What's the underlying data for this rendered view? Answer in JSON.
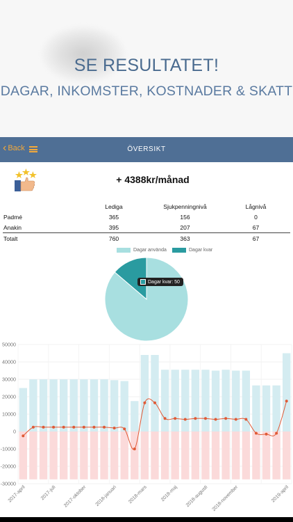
{
  "promo": {
    "title": "SE RESULTATET!",
    "subtitle": "DAGAR, INKOMSTER, KOSTNADER & SKATT"
  },
  "nav": {
    "back_label": "Back",
    "title": "ÖVERSIKT",
    "icons": [
      "chevron-left-icon",
      "hamburger-menu-icon"
    ],
    "accent_color": "#f3a93a",
    "bar_color": "#4f6f95"
  },
  "summary": {
    "icon": "thumbs-up-stars-icon",
    "headline": "+ 4388kr/månad",
    "columns": [
      "",
      "Lediga",
      "Sjukpenningnivå",
      "Lågnivå"
    ],
    "rows": [
      {
        "name": "Padmé",
        "values": [
          "365",
          "156",
          "0"
        ]
      },
      {
        "name": "Anakin",
        "values": [
          "395",
          "207",
          "67"
        ]
      }
    ],
    "total": {
      "name": "Totalt",
      "values": [
        "760",
        "363",
        "67"
      ]
    }
  },
  "pie": {
    "legend": [
      "Dagar använda",
      "Dagar kvar"
    ],
    "colors": [
      "#a8dfe0",
      "#2a9ba0"
    ],
    "tooltip": "Dagar kvar: 50",
    "chart_data": {
      "type": "pie",
      "labels": [
        "Dagar använda",
        "Dagar kvar"
      ],
      "values": [
        313,
        50
      ]
    }
  },
  "chart_data": {
    "type": "bar",
    "ylim": [
      -30000,
      50000
    ],
    "y_ticks": [
      "50000",
      "40000",
      "30000",
      "20000",
      "10000",
      "0",
      "-10000",
      "-20000",
      "-30000"
    ],
    "x_labels": [
      "2017-april",
      "2017-juli",
      "2017-oktober",
      "2018-januari",
      "2018-mars",
      "2018-maj",
      "2018-augusti",
      "2018-november",
      "2019-april"
    ],
    "bar_color_positive": "#d4ecf1",
    "bar_color_negative": "#fbdada",
    "line_color": "#e05a36",
    "positive": [
      25000,
      30000,
      30000,
      30000,
      30000,
      30000,
      30000,
      30000,
      30000,
      29500,
      29000,
      17500,
      44000,
      44000,
      35500,
      35500,
      35500,
      35500,
      35500,
      35000,
      35500,
      35000,
      35000,
      26500,
      26500,
      26500,
      45000
    ],
    "negative": [
      -27500,
      -27500,
      -27500,
      -27500,
      -27500,
      -27500,
      -27500,
      -27500,
      -27500,
      -27500,
      -27500,
      -27500,
      -27500,
      -27500,
      -27500,
      -27500,
      -27500,
      -27500,
      -27500,
      -27500,
      -27500,
      -27500,
      -27500,
      -27500,
      -27500,
      -27500,
      -27500
    ],
    "net": [
      -2500,
      2500,
      2500,
      2500,
      2500,
      2500,
      2500,
      2500,
      2500,
      2000,
      1500,
      -10000,
      16500,
      16500,
      7500,
      7500,
      7000,
      7500,
      7500,
      7000,
      7500,
      7000,
      7000,
      -1000,
      -1500,
      -1000,
      17500
    ]
  }
}
